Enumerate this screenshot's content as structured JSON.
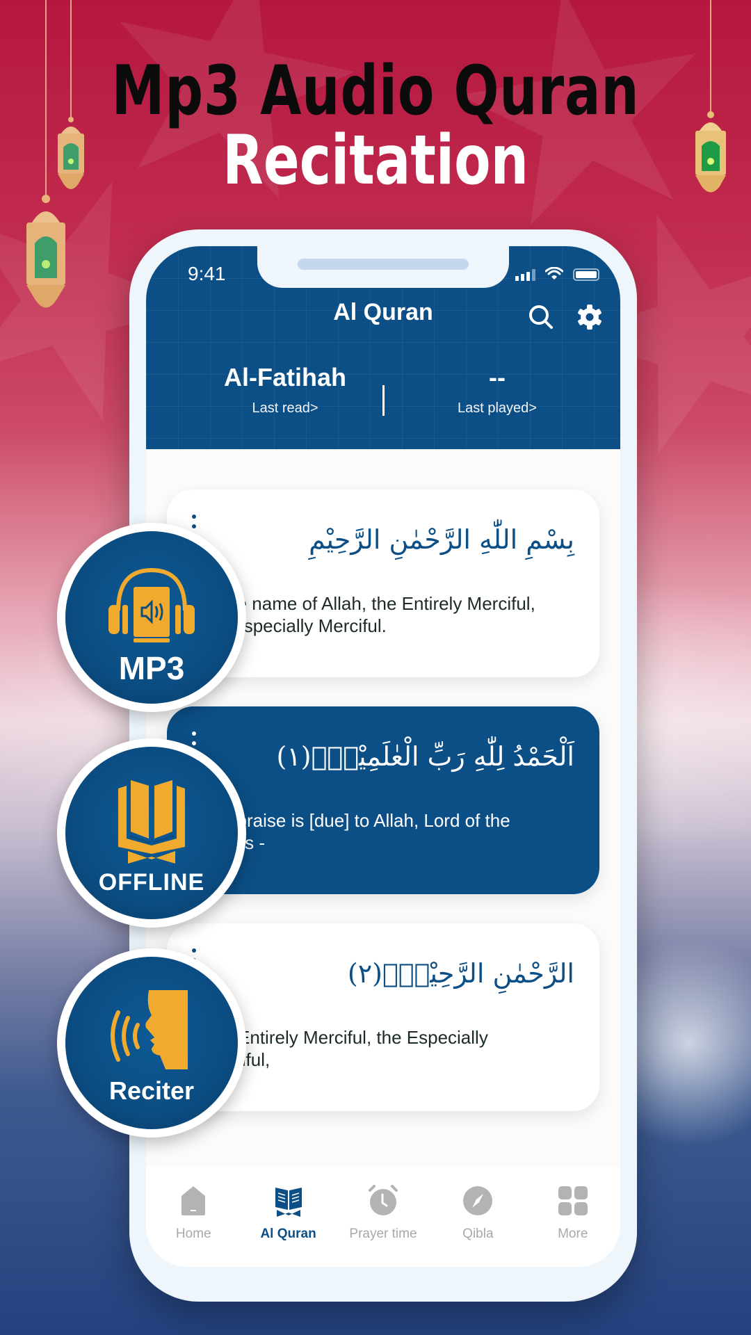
{
  "headline": {
    "line1": "Mp3 Audio Quran",
    "line2": "Recitation"
  },
  "colors": {
    "brand_blue": "#0b4f86",
    "gold": "#f0aa2e",
    "headline_dark": "#0b0b0b",
    "background_red": "#b5173f",
    "background_navy": "#24427f",
    "nav_inactive": "#a8a8a8"
  },
  "status_bar": {
    "time": "9:41",
    "icons": [
      "signal-icon",
      "wifi-icon",
      "battery-icon"
    ]
  },
  "app_header": {
    "title": "Al Quran",
    "actions": [
      {
        "icon": "search-icon"
      },
      {
        "icon": "gear-icon"
      }
    ],
    "last_read": {
      "value": "Al-Fatihah",
      "label": "Last read>"
    },
    "last_played": {
      "value": "--",
      "label": "Last played>"
    }
  },
  "verses": [
    {
      "arabic": "بِسْمِ اللّٰهِ الرَّحْمٰنِ الرَّحِيْمِ",
      "translation": "In the name of Allah, the Entirely Merciful, the Especially Merciful.",
      "visible_translation": "name of Allah, the Entirely Merciful,\npecially Merciful.",
      "active": false
    },
    {
      "arabic": "اَلْحَمْدُ لِلّٰهِ رَبِّ الْعٰلَمِيْنَۙ(١)",
      "translation": "[All] praise is [due] to Allah, Lord of the worlds -",
      "visible_translation": "raise is [due] to Allah, Lord of the\ns -",
      "active": true
    },
    {
      "arabic": "الرَّحْمٰنِ الرَّحِيْمِۙ(٢)",
      "translation": "The Entirely Merciful, the Especially Merciful,",
      "visible_translation": "ntirely Merciful, the Especially\nful,",
      "active": false
    }
  ],
  "bottom_nav": [
    {
      "label": "Home",
      "icon": "home-icon",
      "active": false
    },
    {
      "label": "Al Quran",
      "icon": "quran-book-icon",
      "active": true
    },
    {
      "label": "Prayer time",
      "icon": "alarm-clock-icon",
      "active": false
    },
    {
      "label": "Qibla",
      "icon": "compass-icon",
      "active": false
    },
    {
      "label": "More",
      "icon": "grid-icon",
      "active": false
    }
  ],
  "feature_badges": [
    {
      "label": "MP3",
      "icon": "audiobook-headphones-icon"
    },
    {
      "label": "OFFLINE",
      "icon": "open-quran-icon"
    },
    {
      "label": "Reciter",
      "icon": "speaking-head-icon"
    }
  ]
}
